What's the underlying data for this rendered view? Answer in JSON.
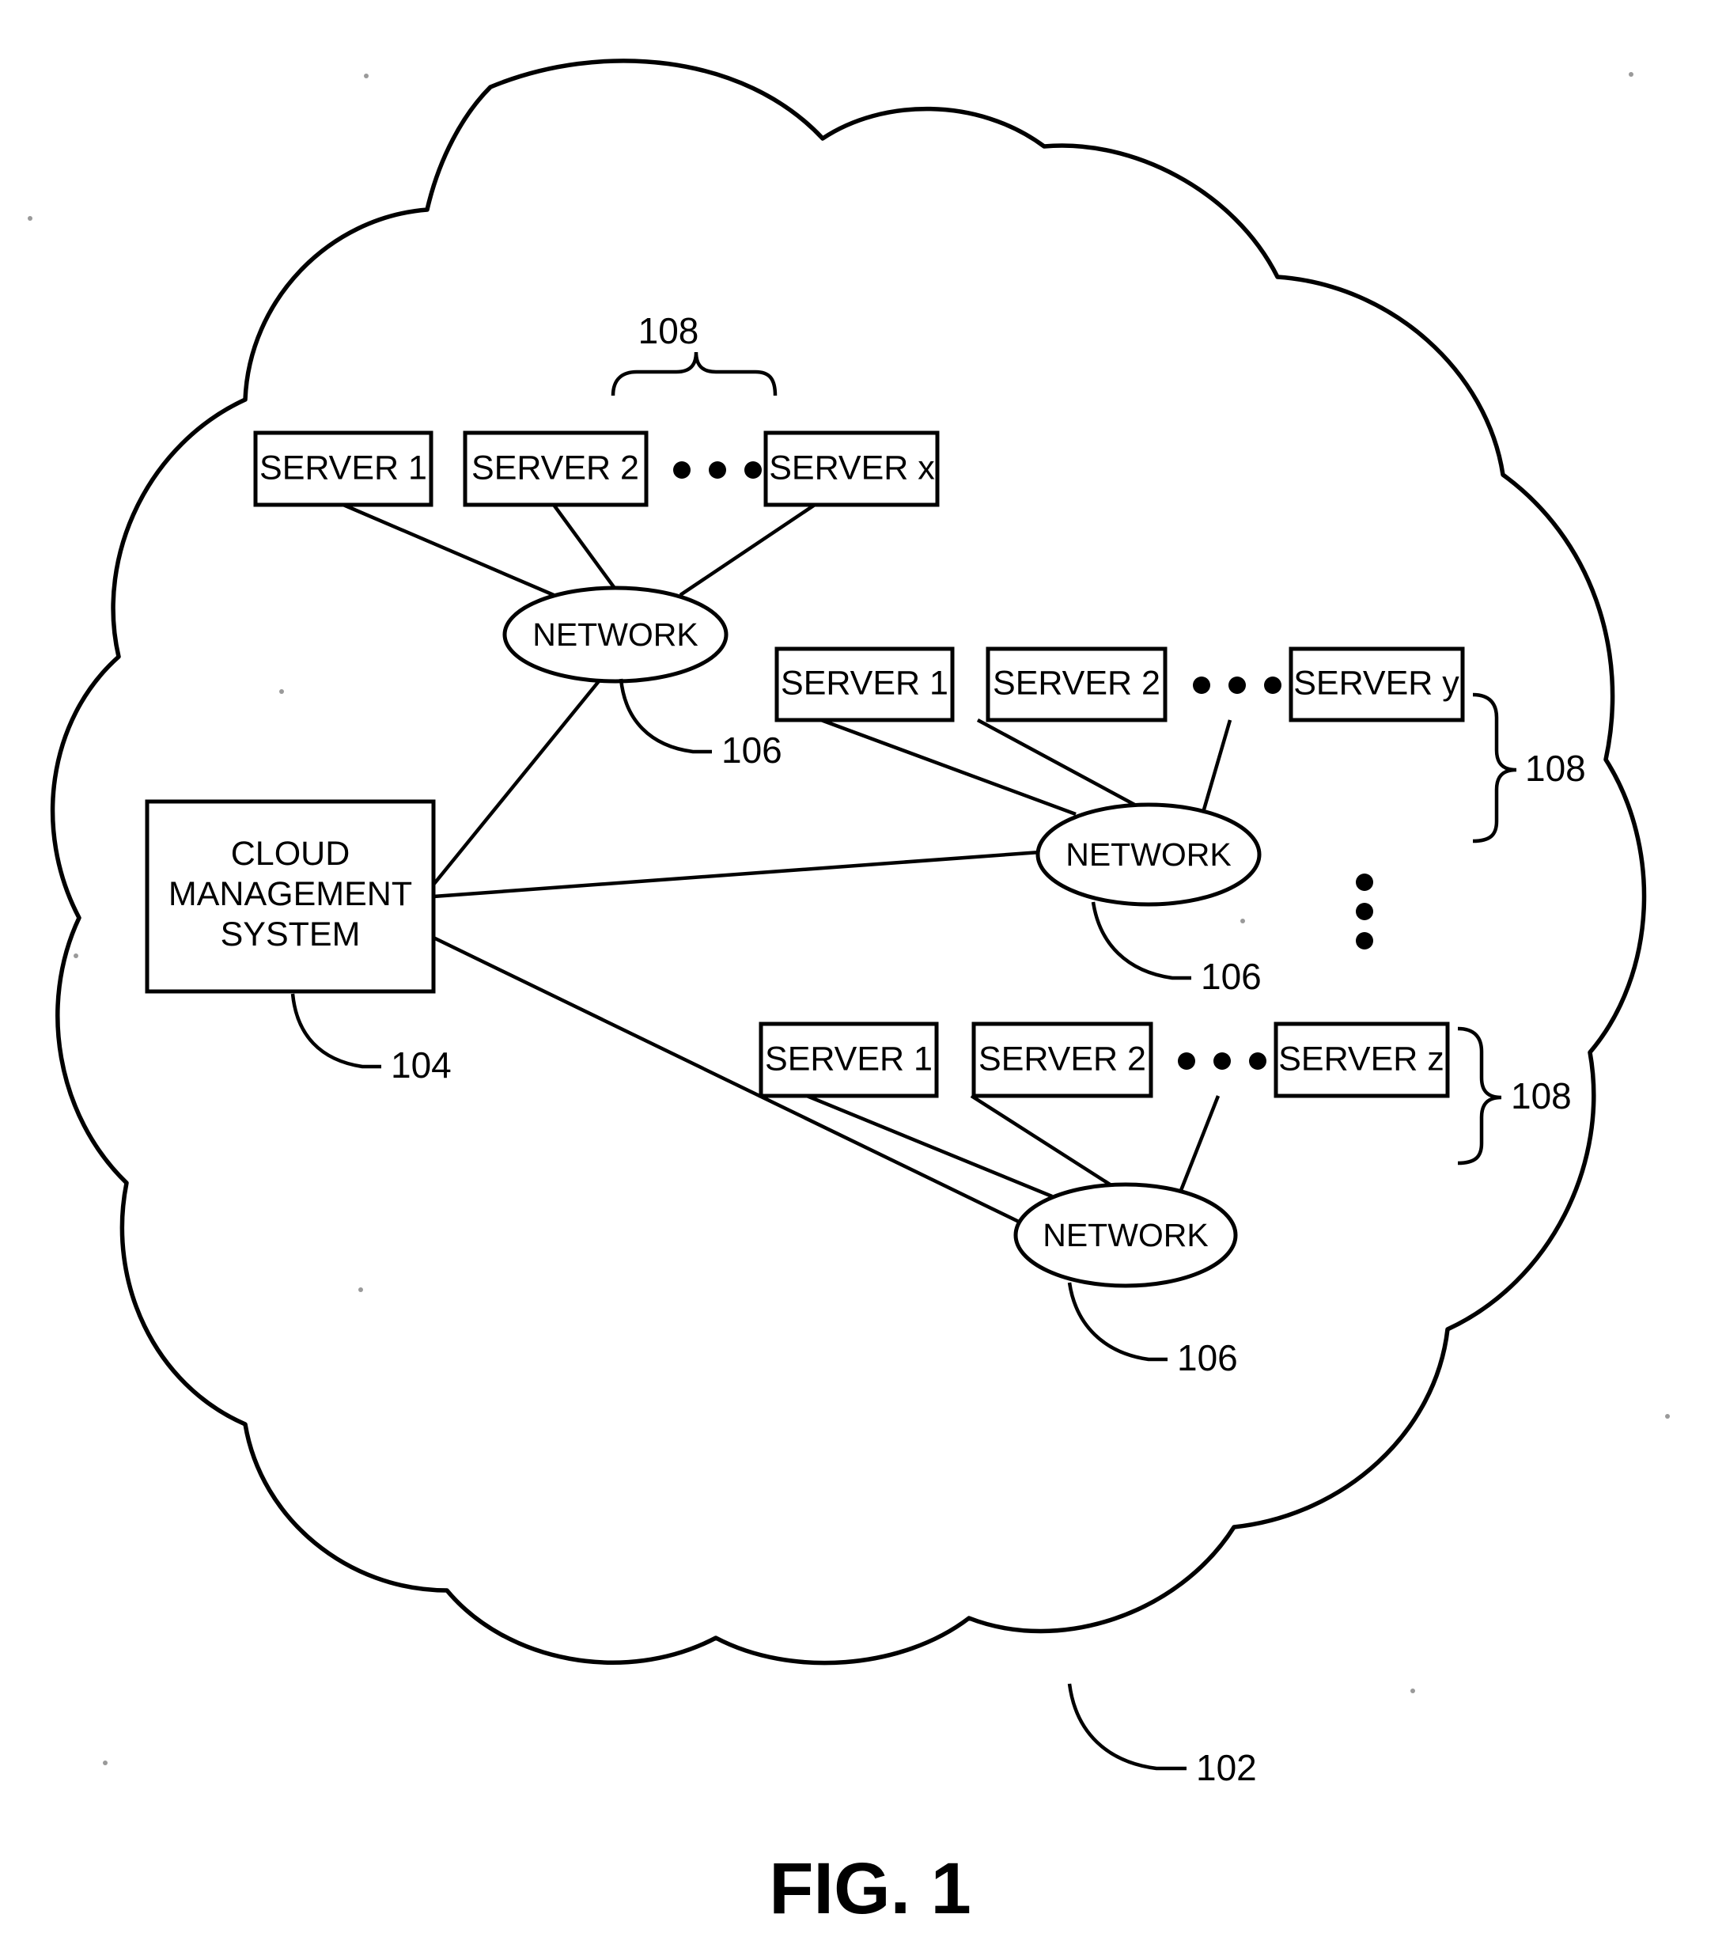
{
  "figure": {
    "caption": "FIG. 1",
    "cloud_label": "102",
    "cloud_label_name": "cloud-boundary-reference"
  },
  "cloud_management_system": {
    "line1": "CLOUD",
    "line2": "MANAGEMENT",
    "line3": "SYSTEM",
    "reference": "104"
  },
  "groups": [
    {
      "id": "group-top",
      "servers": [
        "SERVER 1",
        "SERVER 2",
        "SERVER x"
      ],
      "ellipsis": "• • •",
      "network_label": "NETWORK",
      "network_reference": "106",
      "group_reference": "108"
    },
    {
      "id": "group-middle",
      "servers": [
        "SERVER 1",
        "SERVER 2",
        "SERVER y"
      ],
      "ellipsis": "• • •",
      "network_label": "NETWORK",
      "network_reference": "106",
      "group_reference": "108"
    },
    {
      "id": "group-bottom",
      "servers": [
        "SERVER 1",
        "SERVER 2",
        "SERVER z"
      ],
      "ellipsis": "• • •",
      "network_label": "NETWORK",
      "network_reference": "106",
      "group_reference": "108"
    }
  ],
  "vertical_ellipsis": {
    "label": "vertical-ellipsis-more-groups",
    "dots": 3
  },
  "colors": {
    "ink": "#000000",
    "paper": "#ffffff"
  }
}
